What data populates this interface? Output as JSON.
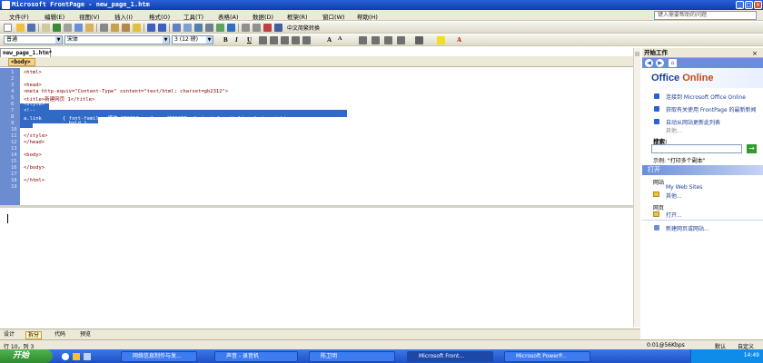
{
  "window": {
    "title": "Microsoft FrontPage - new_page_1.htm"
  },
  "menubar": {
    "items": [
      "文件(F)",
      "编辑(E)",
      "视图(V)",
      "插入(I)",
      "格式(O)",
      "工具(T)",
      "表格(A)",
      "数据(D)",
      "框架(R)",
      "窗口(W)",
      "帮助(H)"
    ],
    "help_placeholder": "键入需要帮助的问题"
  },
  "toolbar": {
    "style_value": "普通",
    "font_value": "宋体",
    "size_value": "3 (12 磅)",
    "convert_label": "中文简繁转换"
  },
  "document": {
    "tab_label": "new_page_1.htm*",
    "tag_badge": "<body>",
    "line_numbers": [
      "1",
      "2",
      "3",
      "4",
      "5",
      "6",
      "7",
      "8",
      "9",
      "10",
      "11",
      "12",
      "13",
      "14",
      "15",
      "16",
      "17",
      "18",
      "19"
    ],
    "code_lines": [
      "<html>",
      "",
      "<head>",
      "<meta http-equiv=\"Content-Type\" content=\"text/html; charset=gb2312\">",
      "<title>新建网页 1</title>",
      "<style>",
      "<!--",
      "a.link       { font-family: 楷体_GB2312; color: #FF00FF; font-style: italic; font-weight:",
      "               bold }",
      "-->",
      "</style>",
      "</head>",
      "",
      "<body>",
      "",
      "</body>",
      "",
      "</html>",
      ""
    ]
  },
  "view_tabs": [
    "设计",
    "拆分",
    "代码",
    "预览"
  ],
  "taskpane": {
    "title": "开始工作",
    "office_brand": "Office",
    "office_online": "Online",
    "links": [
      "连接到 Microsoft Office Online",
      "获取有关使用 FrontPage 的最新新闻",
      "自动从网站更新此列表"
    ],
    "more": "其他...",
    "search_label": "搜索:",
    "example": "示例: \"打印多个副本\"",
    "open_section": "打开",
    "site_label": "网站",
    "site_item": "My Web Sites",
    "site_more": "其他...",
    "page_label": "网页",
    "page_open": "打开...",
    "new_page_site": "新建网页或网站..."
  },
  "statusbar": {
    "position": "行 10，列 3",
    "download": "0:01@56Kbps",
    "mode": "默认",
    "custom": "自定义"
  },
  "taskbar": {
    "start": "开始",
    "tasks": [
      "网络信息制作与发...",
      "声音 - 录音机",
      "陈卫明",
      "Microsoft Front...",
      "Microsoft PowerP..."
    ],
    "clock": "14:49"
  }
}
